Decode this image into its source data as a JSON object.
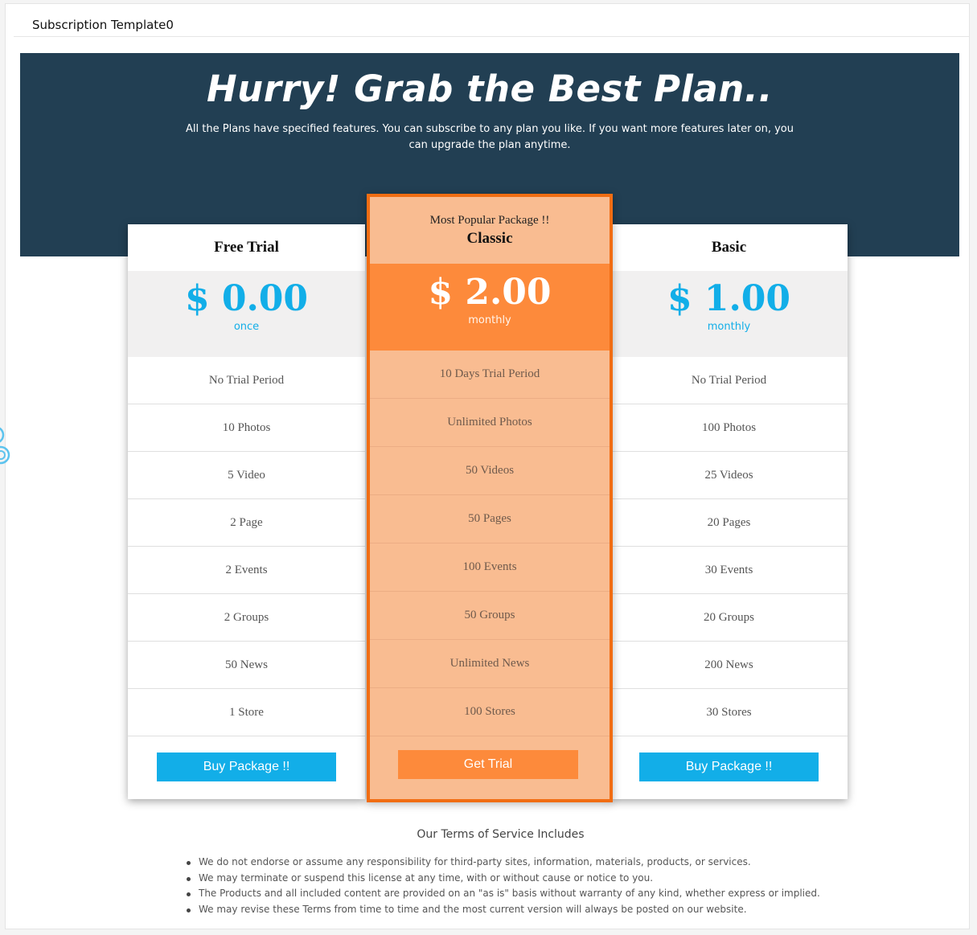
{
  "window": {
    "title": "Subscription Template0"
  },
  "hero": {
    "heading": "Hurry! Grab the Best Plan..",
    "description": "All the Plans have specified features. You can subscribe to any plan you like. If you want more features later on, you can upgrade the plan anytime."
  },
  "plans": {
    "free": {
      "name": "Free Trial",
      "price": "$ 0.00",
      "period": "once",
      "features": [
        "No Trial Period",
        "10 Photos",
        "5 Video",
        "2 Page",
        "2 Events",
        "2 Groups",
        "50 News",
        "1 Store"
      ],
      "button": "Buy Package !!"
    },
    "classic": {
      "badge": "Most Popular Package !!",
      "name": "Classic",
      "price": "$ 2.00",
      "period": "monthly",
      "features": [
        "10 Days Trial Period",
        "Unlimited Photos",
        "50 Videos",
        "50 Pages",
        "100 Events",
        "50 Groups",
        "Unlimited News",
        "100 Stores"
      ],
      "button": "Get Trial"
    },
    "basic": {
      "name": "Basic",
      "price": "$ 1.00",
      "period": "monthly",
      "features": [
        "No Trial Period",
        "100 Photos",
        "25 Videos",
        "20 Pages",
        "30 Events",
        "20 Groups",
        "200 News",
        "30 Stores"
      ],
      "button": "Buy Package !!"
    }
  },
  "terms": {
    "heading": "Our Terms of Service Includes",
    "items": [
      "We do not endorse or assume any responsibility for third-party sites, information, materials, products, or services.",
      "We may terminate or suspend this license at any time, with or without cause or notice to you.",
      "The Products and all included content are provided on an \"as is\" basis without warranty of any kind, whether express or implied.",
      "We may revise these Terms from time to time and the most current version will always be posted on our website."
    ]
  },
  "colors": {
    "hero_bg": "#223f53",
    "accent_blue": "#12aee8",
    "accent_orange": "#fd8a3b",
    "classic_border": "#f16d13",
    "classic_bg": "#f9bc91"
  }
}
